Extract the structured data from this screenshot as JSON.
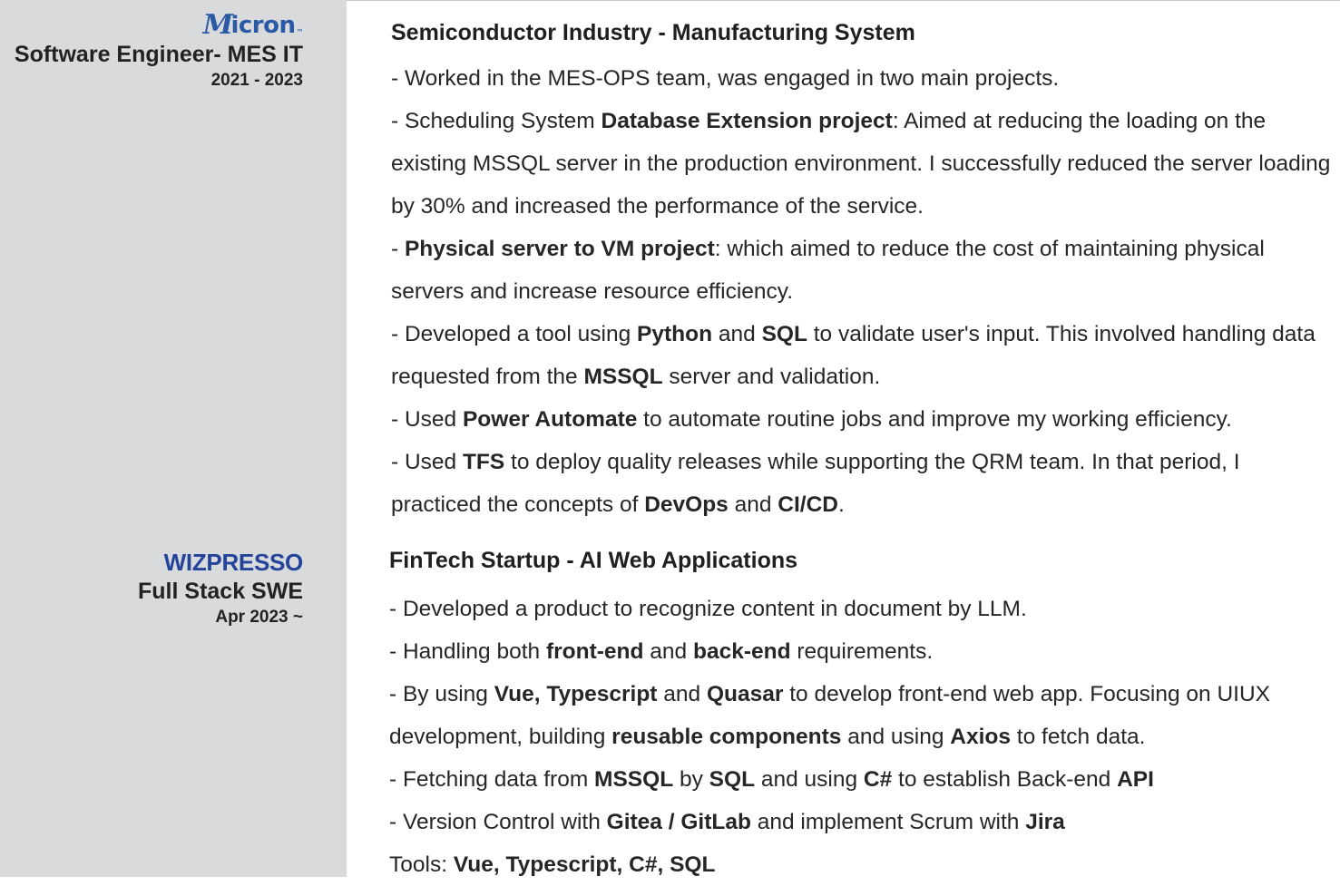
{
  "jobs": [
    {
      "logo": "Micron",
      "role": "Software Engineer- MES IT",
      "period": "2021 - 2023",
      "heading": "Semiconductor Industry - Manufacturing System",
      "paragraphs": [
        [
          {
            "t": "- Worked in the MES-OPS team, was engaged in two main projects."
          }
        ],
        [
          {
            "t": "- Scheduling System "
          },
          {
            "t": "Database Extension project",
            "b": true
          },
          {
            "t": ": Aimed at reducing the loading on the existing MSSQL server in the production environment. I successfully reduced the server loading by 30% and increased the performance of the service."
          }
        ],
        [
          {
            "t": "- "
          },
          {
            "t": "Physical server to VM project",
            "b": true
          },
          {
            "t": ": which aimed to reduce the cost of maintaining physical servers and increase resource efficiency."
          }
        ],
        [
          {
            "t": "- Developed a tool using "
          },
          {
            "t": "Python",
            "b": true
          },
          {
            "t": " and "
          },
          {
            "t": "SQL",
            "b": true
          },
          {
            "t": " to validate user's input. This involved handling data requested from the "
          },
          {
            "t": "MSSQL",
            "b": true
          },
          {
            "t": " server and validation."
          }
        ],
        [
          {
            "t": "- Used "
          },
          {
            "t": "Power Automate",
            "b": true
          },
          {
            "t": " to automate routine jobs and improve my working efficiency."
          }
        ],
        [
          {
            "t": "- Used "
          },
          {
            "t": "TFS",
            "b": true
          },
          {
            "t": " to deploy quality releases while supporting the QRM team. In that period, I practiced the concepts of "
          },
          {
            "t": "DevOps",
            "b": true
          },
          {
            "t": " and "
          },
          {
            "t": "CI/CD",
            "b": true
          },
          {
            "t": "."
          }
        ]
      ]
    },
    {
      "logo": "WIZPRESSO",
      "role": "Full Stack SWE",
      "period": "Apr 2023 ~",
      "heading": "FinTech Startup - AI Web Applications",
      "paragraphs": [
        [
          {
            "t": "- Developed a product to recognize content in document by LLM."
          }
        ],
        [
          {
            "t": "- Handling both "
          },
          {
            "t": "front-end",
            "b": true
          },
          {
            "t": " and "
          },
          {
            "t": "back-end",
            "b": true
          },
          {
            "t": " requirements."
          }
        ],
        [
          {
            "t": "- By using "
          },
          {
            "t": "Vue, Typescript",
            "b": true
          },
          {
            "t": " and "
          },
          {
            "t": "Quasar",
            "b": true
          },
          {
            "t": " to develop front-end web app. Focusing on UIUX development, building "
          },
          {
            "t": "reusable components",
            "b": true
          },
          {
            "t": " and using "
          },
          {
            "t": "Axios",
            "b": true
          },
          {
            "t": " to fetch data."
          }
        ],
        [
          {
            "t": "- Fetching data from "
          },
          {
            "t": "MSSQL",
            "b": true
          },
          {
            "t": " by "
          },
          {
            "t": "SQL",
            "b": true
          },
          {
            "t": " and using "
          },
          {
            "t": "C#",
            "b": true
          },
          {
            "t": " to establish Back-end "
          },
          {
            "t": "API",
            "b": true
          }
        ],
        [
          {
            "t": "- Version Control with "
          },
          {
            "t": "Gitea / GitLab",
            "b": true
          },
          {
            "t": " and implement Scrum with "
          },
          {
            "t": "Jira",
            "b": true
          }
        ],
        [
          {
            "t": "Tools: "
          },
          {
            "t": "Vue, Typescript, C#, SQL",
            "b": true
          }
        ]
      ]
    }
  ],
  "colors": {
    "sidebar_bg": "#d9dadb",
    "micron_blue": "#2a5aa6",
    "wizpresso_blue": "#24439b",
    "text": "#262626"
  }
}
